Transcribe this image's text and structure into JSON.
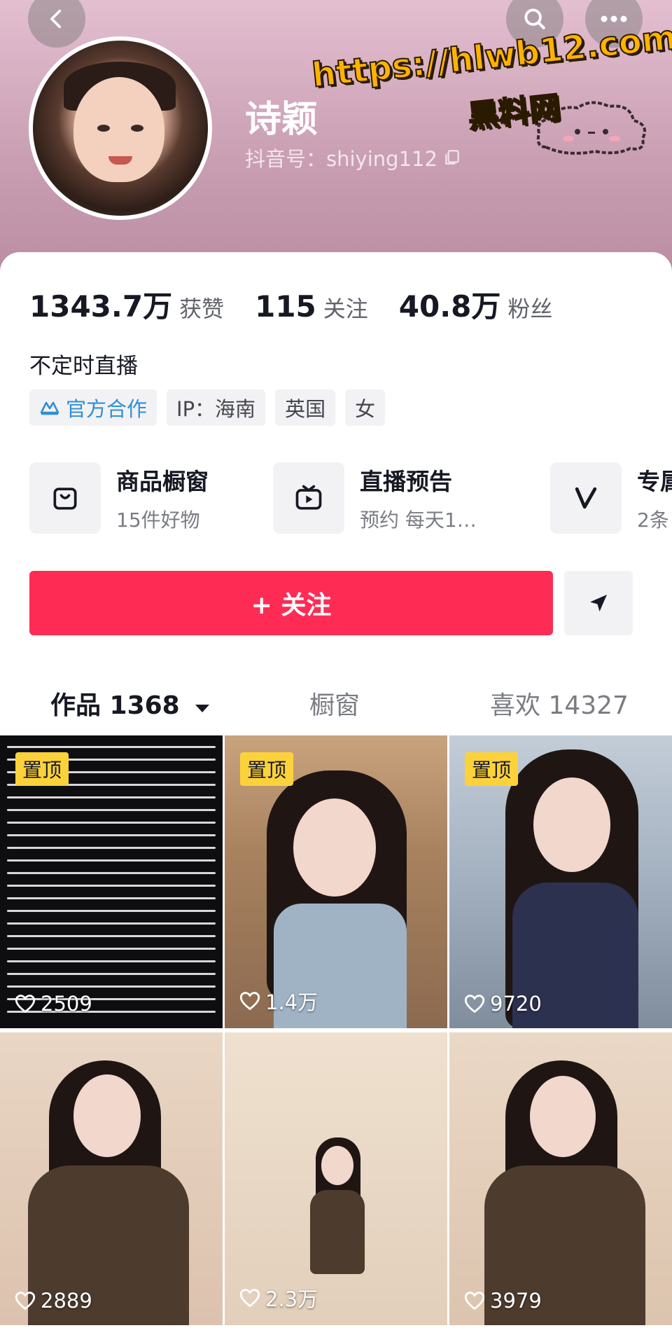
{
  "profile": {
    "nickname": "诗颖",
    "douyin_id": "抖音号：shiying112",
    "bio": "不定时直播"
  },
  "watermark": {
    "url": "https://hlwb12.com",
    "site": "黑料网"
  },
  "stats": [
    {
      "value": "1343.7万",
      "label": "获赞"
    },
    {
      "value": "115",
      "label": "关注"
    },
    {
      "value": "40.8万",
      "label": "粉丝"
    }
  ],
  "tags": [
    {
      "label": "官方合作",
      "icon": "official-partner-icon"
    },
    {
      "label": "IP：海南"
    },
    {
      "label": "英国"
    },
    {
      "label": "女"
    }
  ],
  "services": [
    {
      "title": "商品橱窗",
      "subtitle": "15件好物",
      "icon": "shopping-bag-icon"
    },
    {
      "title": "直播预告",
      "subtitle": "预约 每天1…",
      "icon": "live-tv-icon"
    },
    {
      "title": "专属",
      "subtitle": "2条",
      "icon": "v-badge-icon"
    }
  ],
  "actions": {
    "follow": "+ 关注"
  },
  "tabs": [
    {
      "label": "作品 1368"
    },
    {
      "label": "橱窗"
    },
    {
      "label": "喜欢 14327"
    }
  ],
  "videos": [
    {
      "pinned": "置顶",
      "likes": "2509"
    },
    {
      "pinned": "置顶",
      "likes": "1.4万"
    },
    {
      "pinned": "置顶",
      "likes": "9720"
    },
    {
      "likes": "2889"
    },
    {
      "likes": "2.3万"
    },
    {
      "likes": "3979"
    }
  ],
  "colors": {
    "accent": "#fe2c55",
    "pin_badge": "#fcd23b",
    "header_bg": "#c99eb2",
    "official_blue": "#2f8fd8"
  }
}
